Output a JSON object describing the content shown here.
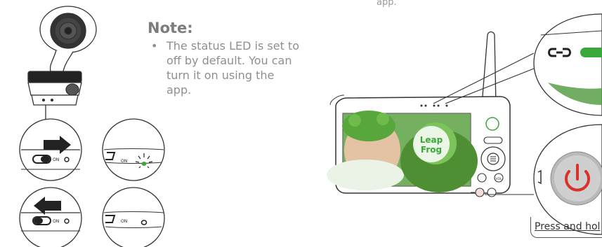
{
  "top_text": "app.",
  "note": {
    "title": "Note:",
    "bullet": "•",
    "body": "The status LED is set to off by default. You can turn it on using the app."
  },
  "switch_label": "ON",
  "logo": {
    "line1": "Leap",
    "line2": "Frog"
  },
  "buttons": {
    "vol": "VOL"
  },
  "press_label": "Press and hol",
  "icons": [
    "camera-unit",
    "arrow-right-icon",
    "arrow-left-icon",
    "led-icon",
    "link-icon",
    "power-icon",
    "menu-icon",
    "zoom-icon",
    "talk-icon"
  ],
  "colors": {
    "led_green": "#3aa83a",
    "power_red": "#d8332a",
    "screen_green": "#4e9a3c",
    "line": "#333333"
  }
}
